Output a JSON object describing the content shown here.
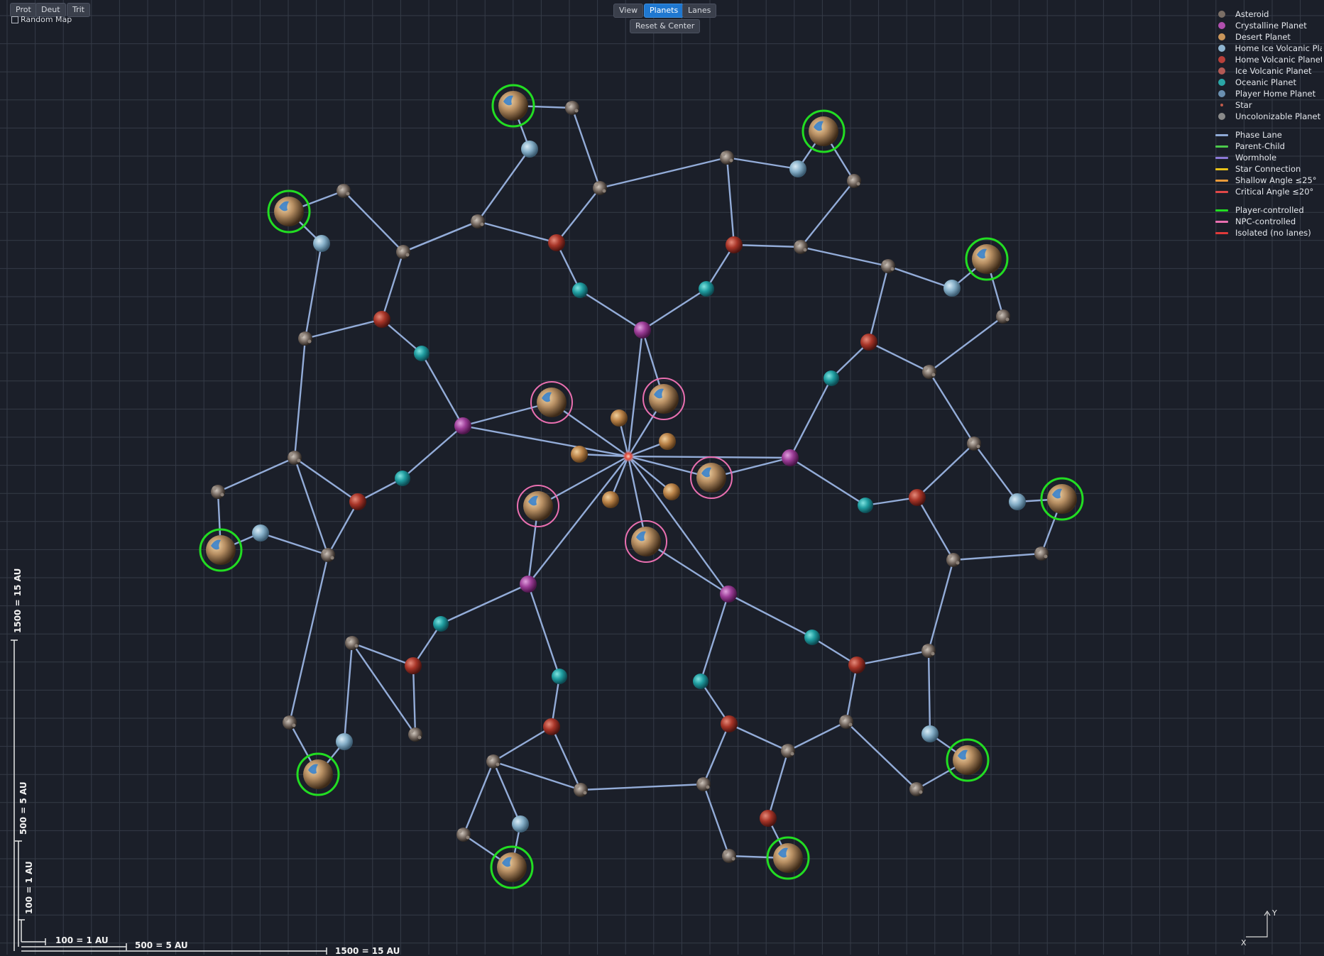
{
  "toolbar": {
    "resource_buttons": [
      "Prot",
      "Deut",
      "Trit"
    ],
    "random_map_label": "Random Map",
    "view_buttons": [
      "View",
      "Planets",
      "Lanes"
    ],
    "active_view": "Planets",
    "reset_label": "Reset & Center"
  },
  "legend": {
    "planet_types": [
      {
        "label": "Asteroid",
        "color": "#7b6f66"
      },
      {
        "label": "Crystalline Planet",
        "color": "#b14fae"
      },
      {
        "label": "Desert Planet",
        "color": "#c9955a"
      },
      {
        "label": "Home Ice Volcanic Pla",
        "color": "#8fb4cf"
      },
      {
        "label": "Home Volcanic Planet",
        "color": "#b8403a"
      },
      {
        "label": "Ice Volcanic Planet",
        "color": "#b45a55"
      },
      {
        "label": "Oceanic Planet",
        "color": "#2aa6a6"
      },
      {
        "label": "Player Home Planet",
        "color": "#6a8fb0"
      },
      {
        "label": "Star",
        "color": "#c05a4a"
      },
      {
        "label": "Uncolonizable Planet",
        "color": "#8a8a8a"
      }
    ],
    "lane_types": [
      {
        "label": "Phase Lane",
        "color": "#8fa9d6"
      },
      {
        "label": "Parent-Child",
        "color": "#4cc94c"
      },
      {
        "label": "Wormhole",
        "color": "#8c79d6"
      },
      {
        "label": "Star Connection",
        "color": "#e8c21a"
      },
      {
        "label": "Shallow Angle ≤25°",
        "color": "#e89a3a"
      },
      {
        "label": "Critical Angle ≤20°",
        "color": "#e04848"
      }
    ],
    "control_types": [
      {
        "label": "Player-controlled",
        "color": "#22dd22"
      },
      {
        "label": "NPC-controlled",
        "color": "#e96fb0"
      },
      {
        "label": "Isolated (no lanes)",
        "color": "#e03a3a"
      }
    ]
  },
  "scale": {
    "horizontal": [
      "100 = 1 AU",
      "500 = 5 AU",
      "1500 = 15 AU"
    ],
    "vertical": [
      "100 = 1 AU",
      "500 = 5 AU",
      "1500 = 15 AU"
    ]
  },
  "axes": {
    "x": "X",
    "y": "Y"
  },
  "colors": {
    "background": "#1b1f29",
    "grid": "#353b47",
    "lane": "#93acd8",
    "player_ring": "#22dd22",
    "npc_ring": "#e96fb0"
  },
  "map": {
    "nodes": [
      [
        "star",
        885,
        643
      ],
      [
        "crystal",
        905,
        465
      ],
      [
        "crystal",
        652,
        600
      ],
      [
        "crystal",
        1113,
        645
      ],
      [
        "crystal",
        744,
        823
      ],
      [
        "crystal",
        1026,
        837
      ],
      [
        "desert",
        872,
        589
      ],
      [
        "desert",
        940,
        622
      ],
      [
        "desert",
        816,
        640
      ],
      [
        "desert",
        946,
        693
      ],
      [
        "desert",
        860,
        704
      ],
      [
        "npchome",
        777,
        567
      ],
      [
        "npchome",
        935,
        562
      ],
      [
        "npchome",
        1002,
        673
      ],
      [
        "npchome",
        758,
        713
      ],
      [
        "npchome",
        910,
        763
      ],
      [
        "ocean",
        817,
        409
      ],
      [
        "ocean",
        995,
        407
      ],
      [
        "ocean",
        594,
        498
      ],
      [
        "ocean",
        567,
        674
      ],
      [
        "ocean",
        1171,
        533
      ],
      [
        "ocean",
        1219,
        712
      ],
      [
        "ocean",
        621,
        879
      ],
      [
        "ocean",
        788,
        953
      ],
      [
        "ocean",
        987,
        960
      ],
      [
        "ocean",
        1144,
        898
      ],
      [
        "ivolc",
        784,
        342
      ],
      [
        "ivolc",
        1034,
        345
      ],
      [
        "ivolc",
        538,
        450
      ],
      [
        "ivolc",
        1224,
        482
      ],
      [
        "ivolc",
        504,
        707
      ],
      [
        "ivolc",
        1292,
        701
      ],
      [
        "ivolc",
        582,
        938
      ],
      [
        "ivolc",
        777,
        1024
      ],
      [
        "ivolc",
        1027,
        1020
      ],
      [
        "ivolc",
        1207,
        937
      ],
      [
        "ivolc",
        1082,
        1153
      ],
      [
        "ice",
        746,
        210
      ],
      [
        "ice",
        1124,
        238
      ],
      [
        "ice",
        453,
        343
      ],
      [
        "ice",
        1341,
        406
      ],
      [
        "ice",
        367,
        751
      ],
      [
        "ice",
        1433,
        707
      ],
      [
        "ice",
        485,
        1045
      ],
      [
        "ice",
        1310,
        1034
      ],
      [
        "ice",
        733,
        1161
      ],
      [
        "ast",
        806,
        152
      ],
      [
        "ast",
        1024,
        222
      ],
      [
        "ast",
        845,
        265
      ],
      [
        "ast",
        1203,
        255
      ],
      [
        "ast",
        673,
        312
      ],
      [
        "ast",
        1128,
        348
      ],
      [
        "ast",
        484,
        269
      ],
      [
        "ast",
        1251,
        375
      ],
      [
        "ast",
        568,
        355
      ],
      [
        "ast",
        1413,
        446
      ],
      [
        "ast",
        430,
        477
      ],
      [
        "ast",
        1309,
        524
      ],
      [
        "ast",
        415,
        645
      ],
      [
        "ast",
        1372,
        625
      ],
      [
        "ast",
        307,
        693
      ],
      [
        "ast",
        1467,
        780
      ],
      [
        "ast",
        462,
        782
      ],
      [
        "ast",
        1343,
        789
      ],
      [
        "ast",
        496,
        906
      ],
      [
        "ast",
        1308,
        917
      ],
      [
        "ast",
        408,
        1018
      ],
      [
        "ast",
        585,
        1035
      ],
      [
        "ast",
        1192,
        1017
      ],
      [
        "ast",
        695,
        1073
      ],
      [
        "ast",
        1110,
        1058
      ],
      [
        "ast",
        818,
        1113
      ],
      [
        "ast",
        991,
        1105
      ],
      [
        "ast",
        653,
        1176
      ],
      [
        "ast",
        1027,
        1206
      ],
      [
        "ast",
        1291,
        1112
      ],
      [
        "phome",
        723,
        149
      ],
      [
        "phome",
        1160,
        185
      ],
      [
        "phome",
        407,
        298
      ],
      [
        "phome",
        1390,
        365
      ],
      [
        "phome",
        1496,
        703
      ],
      [
        "phome",
        311,
        775
      ],
      [
        "phome",
        1363,
        1071
      ],
      [
        "phome",
        448,
        1091
      ],
      [
        "phome",
        721,
        1222
      ],
      [
        "phome",
        1110,
        1209
      ]
    ],
    "lanes": [
      [
        885,
        643,
        905,
        465
      ],
      [
        885,
        643,
        652,
        600
      ],
      [
        885,
        643,
        1113,
        645
      ],
      [
        885,
        643,
        744,
        823
      ],
      [
        885,
        643,
        1026,
        837
      ],
      [
        885,
        643,
        872,
        589
      ],
      [
        885,
        643,
        940,
        622
      ],
      [
        885,
        643,
        816,
        640
      ],
      [
        885,
        643,
        946,
        693
      ],
      [
        885,
        643,
        860,
        704
      ],
      [
        885,
        643,
        777,
        567
      ],
      [
        885,
        643,
        935,
        562
      ],
      [
        885,
        643,
        1002,
        673
      ],
      [
        885,
        643,
        758,
        713
      ],
      [
        885,
        643,
        910,
        763
      ],
      [
        905,
        465,
        817,
        409
      ],
      [
        905,
        465,
        995,
        407
      ],
      [
        652,
        600,
        594,
        498
      ],
      [
        652,
        600,
        567,
        674
      ],
      [
        652,
        600,
        777,
        567
      ],
      [
        1113,
        645,
        1171,
        533
      ],
      [
        1113,
        645,
        1219,
        712
      ],
      [
        1113,
        645,
        1002,
        673
      ],
      [
        744,
        823,
        621,
        879
      ],
      [
        744,
        823,
        788,
        953
      ],
      [
        744,
        823,
        758,
        713
      ],
      [
        1026,
        837,
        987,
        960
      ],
      [
        1026,
        837,
        1144,
        898
      ],
      [
        1026,
        837,
        910,
        763
      ],
      [
        905,
        465,
        935,
        562
      ],
      [
        817,
        409,
        784,
        342
      ],
      [
        995,
        407,
        1034,
        345
      ],
      [
        594,
        498,
        538,
        450
      ],
      [
        567,
        674,
        504,
        707
      ],
      [
        1171,
        533,
        1224,
        482
      ],
      [
        1219,
        712,
        1292,
        701
      ],
      [
        621,
        879,
        582,
        938
      ],
      [
        788,
        953,
        777,
        1024
      ],
      [
        987,
        960,
        1027,
        1020
      ],
      [
        1144,
        898,
        1207,
        937
      ],
      [
        784,
        342,
        845,
        265
      ],
      [
        784,
        342,
        673,
        312
      ],
      [
        1034,
        345,
        1024,
        222
      ],
      [
        1034,
        345,
        1128,
        348
      ],
      [
        538,
        450,
        568,
        355
      ],
      [
        538,
        450,
        430,
        477
      ],
      [
        1224,
        482,
        1251,
        375
      ],
      [
        1224,
        482,
        1309,
        524
      ],
      [
        504,
        707,
        415,
        645
      ],
      [
        504,
        707,
        462,
        782
      ],
      [
        1292,
        701,
        1372,
        625
      ],
      [
        1292,
        701,
        1343,
        789
      ],
      [
        582,
        938,
        496,
        906
      ],
      [
        582,
        938,
        585,
        1035
      ],
      [
        777,
        1024,
        818,
        1113
      ],
      [
        777,
        1024,
        695,
        1073
      ],
      [
        1027,
        1020,
        991,
        1105
      ],
      [
        1027,
        1020,
        1110,
        1058
      ],
      [
        1207,
        937,
        1192,
        1017
      ],
      [
        1207,
        937,
        1308,
        917
      ],
      [
        845,
        265,
        806,
        152
      ],
      [
        845,
        265,
        1024,
        222
      ],
      [
        673,
        312,
        746,
        210
      ],
      [
        673,
        312,
        568,
        355
      ],
      [
        746,
        210,
        723,
        149
      ],
      [
        723,
        149,
        806,
        152
      ],
      [
        1024,
        222,
        1124,
        238
      ],
      [
        1124,
        238,
        1160,
        185
      ],
      [
        1160,
        185,
        1203,
        255
      ],
      [
        1203,
        255,
        1128,
        348
      ],
      [
        1128,
        348,
        1251,
        375
      ],
      [
        1251,
        375,
        1341,
        406
      ],
      [
        1341,
        406,
        1390,
        365
      ],
      [
        1390,
        365,
        1413,
        446
      ],
      [
        1413,
        446,
        1309,
        524
      ],
      [
        1309,
        524,
        1372,
        625
      ],
      [
        1372,
        625,
        1433,
        707
      ],
      [
        1433,
        707,
        1496,
        703
      ],
      [
        1496,
        703,
        1467,
        780
      ],
      [
        1467,
        780,
        1343,
        789
      ],
      [
        1343,
        789,
        1308,
        917
      ],
      [
        1308,
        917,
        1310,
        1034
      ],
      [
        1310,
        1034,
        1363,
        1071
      ],
      [
        1363,
        1071,
        1291,
        1112
      ],
      [
        1291,
        1112,
        1192,
        1017
      ],
      [
        1192,
        1017,
        1110,
        1058
      ],
      [
        1110,
        1058,
        1082,
        1153
      ],
      [
        1082,
        1153,
        1110,
        1209
      ],
      [
        1110,
        1209,
        1027,
        1206
      ],
      [
        1027,
        1206,
        991,
        1105
      ],
      [
        991,
        1105,
        818,
        1113
      ],
      [
        818,
        1113,
        695,
        1073
      ],
      [
        695,
        1073,
        733,
        1161
      ],
      [
        733,
        1161,
        721,
        1222
      ],
      [
        721,
        1222,
        653,
        1176
      ],
      [
        653,
        1176,
        695,
        1073
      ],
      [
        585,
        1035,
        496,
        906
      ],
      [
        496,
        906,
        485,
        1045
      ],
      [
        485,
        1045,
        448,
        1091
      ],
      [
        448,
        1091,
        408,
        1018
      ],
      [
        408,
        1018,
        462,
        782
      ],
      [
        462,
        782,
        415,
        645
      ],
      [
        415,
        645,
        307,
        693
      ],
      [
        307,
        693,
        311,
        775
      ],
      [
        311,
        775,
        367,
        751
      ],
      [
        367,
        751,
        462,
        782
      ],
      [
        415,
        645,
        430,
        477
      ],
      [
        430,
        477,
        453,
        343
      ],
      [
        453,
        343,
        407,
        298
      ],
      [
        407,
        298,
        484,
        269
      ],
      [
        484,
        269,
        568,
        355
      ],
      [
        568,
        355,
        673,
        312
      ]
    ]
  }
}
